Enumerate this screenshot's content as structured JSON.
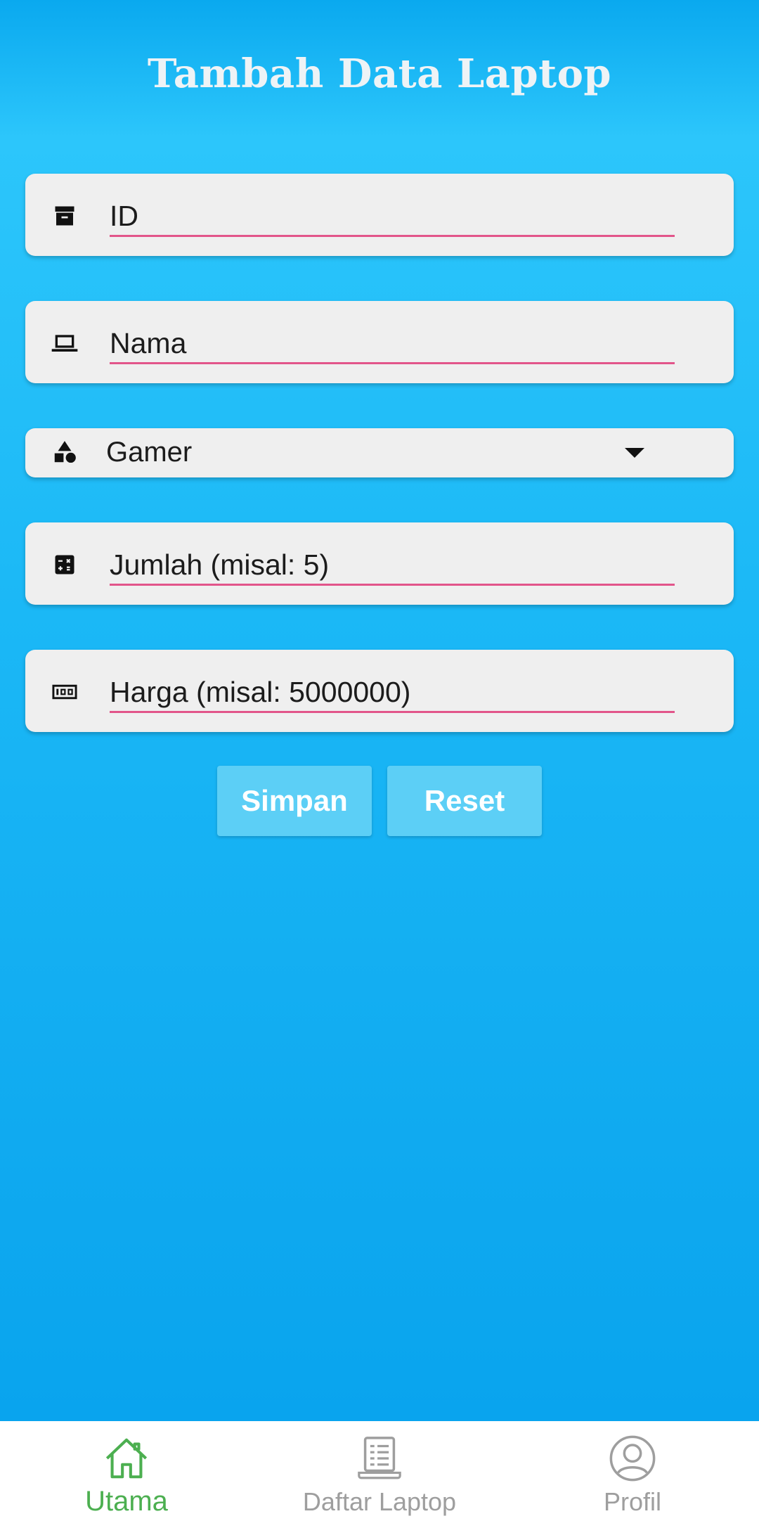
{
  "header": {
    "title": "Tambah Data Laptop"
  },
  "form": {
    "id_placeholder": "ID",
    "nama_placeholder": "Nama",
    "kategori_selected": "Gamer",
    "jumlah_placeholder": "Jumlah (misal: 5)",
    "harga_placeholder": "Harga (misal: 5000000)",
    "icons": {
      "id": "archive-box-icon",
      "nama": "laptop-icon",
      "kategori": "category-shapes-icon",
      "jumlah": "calculator-icon",
      "harga": "money-icon",
      "dropdown": "chevron-down-icon"
    }
  },
  "actions": {
    "save_label": "Simpan",
    "reset_label": "Reset"
  },
  "bottom_nav": {
    "items": [
      {
        "label": "Utama",
        "icon": "home-icon",
        "active": true
      },
      {
        "label": "Daftar Laptop",
        "icon": "laptop-list-icon",
        "active": false
      },
      {
        "label": "Profil",
        "icon": "profile-icon",
        "active": false
      }
    ]
  },
  "colors": {
    "background": "#1bb8f6",
    "field_bg": "#efefef",
    "underline": "#e2558a",
    "button_bg": "#5ccff6",
    "nav_active": "#4caf50",
    "nav_inactive": "#9e9e9e"
  }
}
